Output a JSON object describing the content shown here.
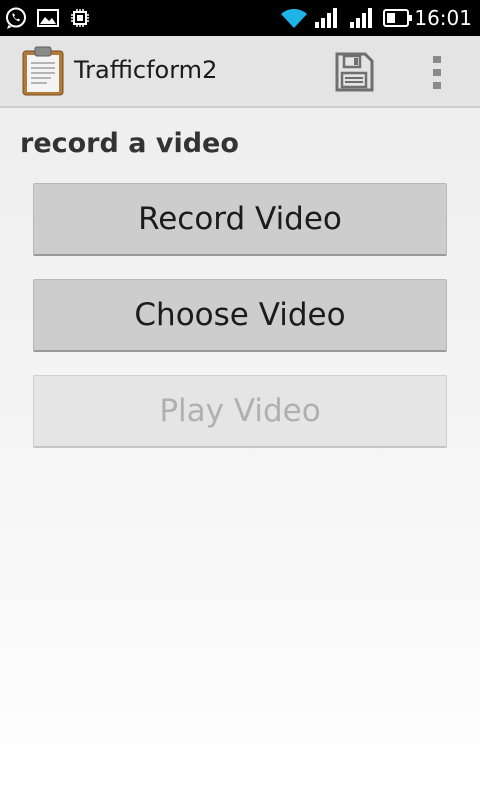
{
  "status_bar": {
    "time": "16:01",
    "icons": [
      "whatsapp-icon",
      "image-icon",
      "chip-icon",
      "wifi-icon",
      "signal-icon",
      "signal-icon",
      "battery-icon"
    ]
  },
  "action_bar": {
    "title": "Trafficform2",
    "icons": [
      "clipboard-icon",
      "save-icon",
      "overflow-menu-icon"
    ]
  },
  "main": {
    "section_title": "record a video",
    "buttons": [
      {
        "label": "Record Video",
        "enabled": true
      },
      {
        "label": "Choose Video",
        "enabled": true
      },
      {
        "label": "Play Video",
        "enabled": false
      }
    ]
  }
}
